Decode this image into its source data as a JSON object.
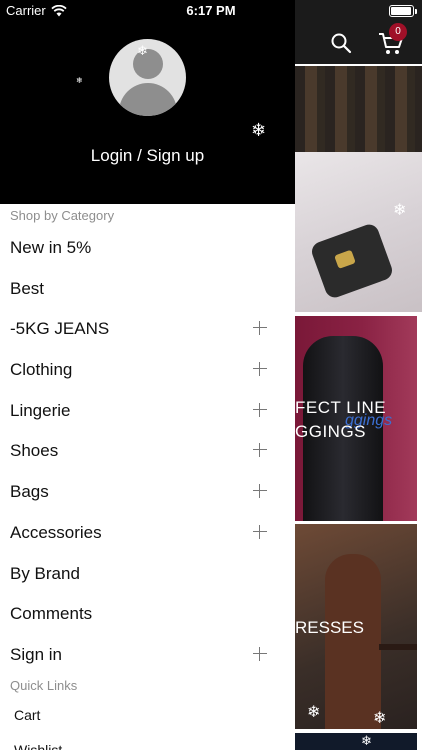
{
  "status_bar": {
    "carrier": "Carrier",
    "time": "6:17 PM"
  },
  "header": {
    "cart_count": "0",
    "search_icon": "search-icon",
    "cart_icon": "cart-icon"
  },
  "banners": {
    "leggings_line1": "FECT LINE",
    "leggings_line2": "GGINGS",
    "leggings_script": "ggings",
    "dresses": "RESSES"
  },
  "drawer": {
    "login_label": "Login / Sign up",
    "category_section_label": "Shop by Category",
    "items": [
      {
        "label": "New in 5%",
        "expandable": false
      },
      {
        "label": "Best",
        "expandable": false
      },
      {
        "label": "-5KG JEANS",
        "expandable": true
      },
      {
        "label": "Clothing",
        "expandable": true
      },
      {
        "label": "Lingerie",
        "expandable": true
      },
      {
        "label": "Shoes",
        "expandable": true
      },
      {
        "label": "Bags",
        "expandable": true
      },
      {
        "label": "Accessories",
        "expandable": true
      },
      {
        "label": "By Brand",
        "expandable": false
      },
      {
        "label": "Comments",
        "expandable": false
      },
      {
        "label": "Sign in",
        "expandable": true
      }
    ],
    "quick_links_label": "Quick Links",
    "quick_links": [
      {
        "label": "Cart"
      },
      {
        "label": "Wishlist"
      }
    ]
  }
}
